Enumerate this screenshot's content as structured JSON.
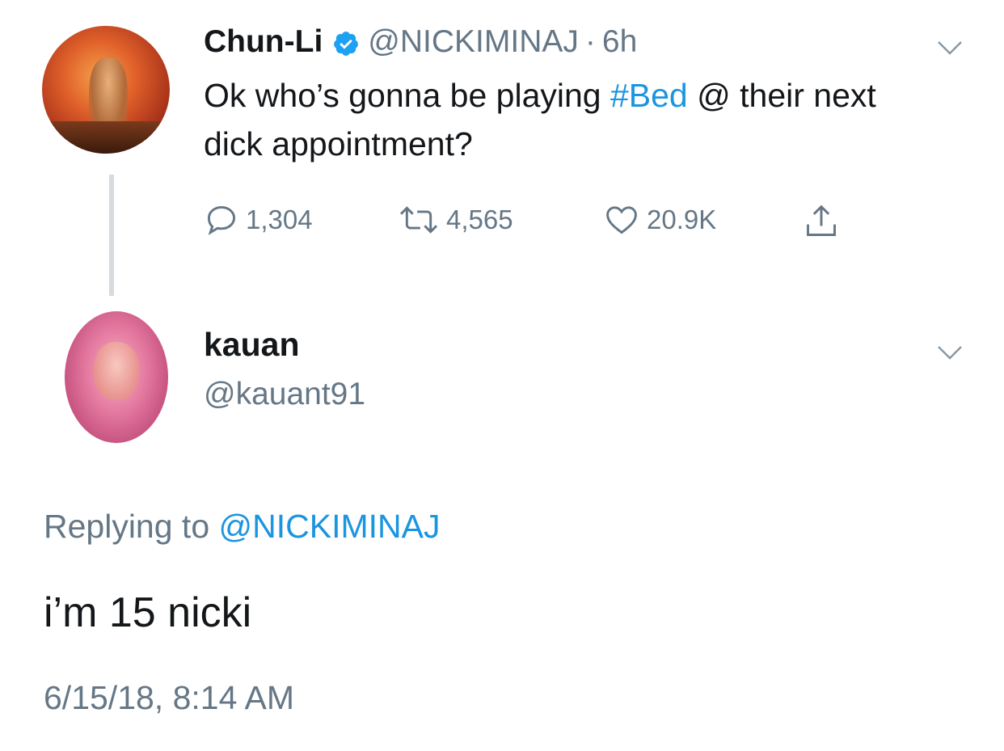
{
  "original_tweet": {
    "display_name": "Chun-Li",
    "verified": true,
    "handle": "@NICKIMINAJ",
    "separator": "·",
    "time_ago": "6h",
    "text_before": "Ok who’s gonna be playing ",
    "hashtag": "#Bed",
    "text_after": " @ their next dick appointment?",
    "stats": {
      "replies": "1,304",
      "retweets": "4,565",
      "likes": "20.9K"
    },
    "icons": [
      "reply-icon",
      "retweet-icon",
      "like-icon",
      "share-icon",
      "verified-badge-icon",
      "chevron-down-icon"
    ]
  },
  "reply_tweet": {
    "display_name": "kauan",
    "handle": "@kauant91",
    "replying_to_label": "Replying to ",
    "replying_to_handle": "@NICKIMINAJ",
    "text": "i’m 15 nicki",
    "timestamp": "6/15/18, 8:14 AM"
  },
  "colors": {
    "link": "#1b95e0",
    "secondary_text": "#657786",
    "primary_text": "#14171a",
    "thread_line": "#d6dbe0"
  }
}
